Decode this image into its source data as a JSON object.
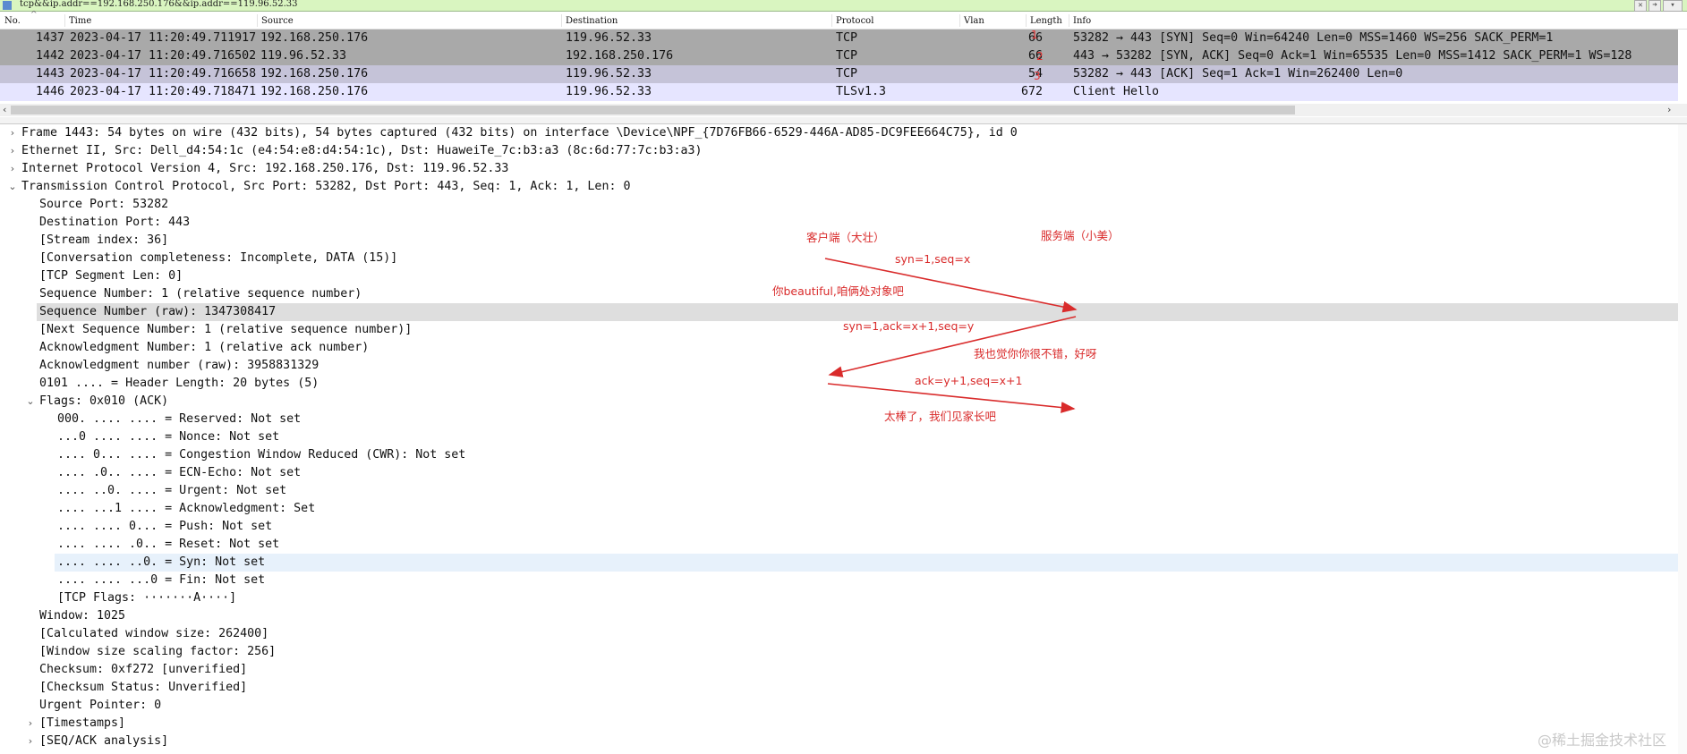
{
  "filter": {
    "text": "tcp&&ip.addr==192.168.250.176&&ip.addr==119.96.52.33"
  },
  "columns": {
    "no": "No.",
    "time": "Time",
    "source": "Source",
    "destination": "Destination",
    "protocol": "Protocol",
    "vlan": "Vlan",
    "length": "Length",
    "info": "Info"
  },
  "packets": [
    {
      "no": "1437",
      "time": "2023-04-17 11:20:49.711917",
      "source": "192.168.250.176",
      "destination": "119.96.52.33",
      "protocol": "TCP",
      "length": "66",
      "info": "53282 → 443 [SYN] Seq=0 Win=64240 Len=0 MSS=1460 WS=256 SACK_PERM=1",
      "bg": "#a9a9a9"
    },
    {
      "no": "1442",
      "time": "2023-04-17 11:20:49.716502",
      "source": "119.96.52.33",
      "destination": "192.168.250.176",
      "protocol": "TCP",
      "length": "66",
      "info": "443 → 53282 [SYN, ACK] Seq=0 Ack=1 Win=65535 Len=0 MSS=1412 SACK_PERM=1 WS=128",
      "bg": "#a9a9a9"
    },
    {
      "no": "1443",
      "time": "2023-04-17 11:20:49.716658",
      "source": "192.168.250.176",
      "destination": "119.96.52.33",
      "protocol": "TCP",
      "length": "54",
      "info": "53282 → 443 [ACK] Seq=1 Ack=1 Win=262400 Len=0",
      "bg": "#c5c3d8"
    },
    {
      "no": "1446",
      "time": "2023-04-17 11:20:49.718471",
      "source": "192.168.250.176",
      "destination": "119.96.52.33",
      "protocol": "TLSv1.3",
      "length": "672",
      "info": "Client Hello",
      "bg": "#e6e5ff"
    }
  ],
  "details": [
    {
      "indent": 0,
      "tw": "›",
      "text": "Frame 1443: 54 bytes on wire (432 bits), 54 bytes captured (432 bits) on interface \\Device\\NPF_{7D76FB66-6529-446A-AD85-DC9FEE664C75}, id 0"
    },
    {
      "indent": 0,
      "tw": "›",
      "text": "Ethernet II, Src: Dell_d4:54:1c (e4:54:e8:d4:54:1c), Dst: HuaweiTe_7c:b3:a3 (8c:6d:77:7c:b3:a3)"
    },
    {
      "indent": 0,
      "tw": "›",
      "text": "Internet Protocol Version 4, Src: 192.168.250.176, Dst: 119.96.52.33"
    },
    {
      "indent": 0,
      "tw": "⌄",
      "text": "Transmission Control Protocol, Src Port: 53282, Dst Port: 443, Seq: 1, Ack: 1, Len: 0"
    },
    {
      "indent": 1,
      "tw": "",
      "text": "Source Port: 53282"
    },
    {
      "indent": 1,
      "tw": "",
      "text": "Destination Port: 443"
    },
    {
      "indent": 1,
      "tw": "",
      "text": "[Stream index: 36]"
    },
    {
      "indent": 1,
      "tw": "",
      "text": "[Conversation completeness: Incomplete, DATA (15)]"
    },
    {
      "indent": 1,
      "tw": "",
      "text": "[TCP Segment Len: 0]"
    },
    {
      "indent": 1,
      "tw": "",
      "text": "Sequence Number: 1    (relative sequence number)"
    },
    {
      "indent": 1,
      "tw": "",
      "text": "Sequence Number (raw): 1347308417",
      "bg": "#dedede"
    },
    {
      "indent": 1,
      "tw": "",
      "text": "[Next Sequence Number: 1    (relative sequence number)]"
    },
    {
      "indent": 1,
      "tw": "",
      "text": "Acknowledgment Number: 1    (relative ack number)"
    },
    {
      "indent": 1,
      "tw": "",
      "text": "Acknowledgment number (raw): 3958831329"
    },
    {
      "indent": 1,
      "tw": "",
      "text": "0101 .... = Header Length: 20 bytes (5)"
    },
    {
      "indent": 1,
      "tw": "⌄",
      "text": "Flags: 0x010 (ACK)"
    },
    {
      "indent": 2,
      "tw": "",
      "text": "000. .... .... = Reserved: Not set"
    },
    {
      "indent": 2,
      "tw": "",
      "text": "...0 .... .... = Nonce: Not set"
    },
    {
      "indent": 2,
      "tw": "",
      "text": ".... 0... .... = Congestion Window Reduced (CWR): Not set"
    },
    {
      "indent": 2,
      "tw": "",
      "text": ".... .0.. .... = ECN-Echo: Not set"
    },
    {
      "indent": 2,
      "tw": "",
      "text": ".... ..0. .... = Urgent: Not set"
    },
    {
      "indent": 2,
      "tw": "",
      "text": ".... ...1 .... = Acknowledgment: Set"
    },
    {
      "indent": 2,
      "tw": "",
      "text": ".... .... 0... = Push: Not set"
    },
    {
      "indent": 2,
      "tw": "",
      "text": ".... .... .0.. = Reset: Not set"
    },
    {
      "indent": 2,
      "tw": "",
      "text": ".... .... ..0. = Syn: Not set",
      "bg": "#e7f1fb"
    },
    {
      "indent": 2,
      "tw": "",
      "text": ".... .... ...0 = Fin: Not set"
    },
    {
      "indent": 2,
      "tw": "",
      "text": "[TCP Flags: ·······A····]"
    },
    {
      "indent": 1,
      "tw": "",
      "text": "Window: 1025"
    },
    {
      "indent": 1,
      "tw": "",
      "text": "[Calculated window size: 262400]"
    },
    {
      "indent": 1,
      "tw": "",
      "text": "[Window size scaling factor: 256]"
    },
    {
      "indent": 1,
      "tw": "",
      "text": "Checksum: 0xf272 [unverified]"
    },
    {
      "indent": 1,
      "tw": "",
      "text": "[Checksum Status: Unverified]"
    },
    {
      "indent": 1,
      "tw": "",
      "text": "Urgent Pointer: 0"
    },
    {
      "indent": 1,
      "tw": "›",
      "text": "[Timestamps]"
    },
    {
      "indent": 1,
      "tw": "›",
      "text": "[SEQ/ACK analysis]"
    }
  ],
  "annotations": {
    "client": "客户端（大壮）",
    "server": "服务端（小美）",
    "step1": "syn=1,seq=x",
    "msg1": "你beautiful,咱俩处对象吧",
    "step2": "syn=1,ack=x+1,seq=y",
    "msg2": "我也觉你你很不错，好呀",
    "step3": "ack=y+1,seq=x+1",
    "msg3": "太棒了，我们见家长吧",
    "n1": "1",
    "n2": "2",
    "n3": "3"
  },
  "watermark": "@稀土掘金技术社区",
  "colors": {
    "annotation": "#d92b2b",
    "filter_bg": "#d9f5c0"
  }
}
